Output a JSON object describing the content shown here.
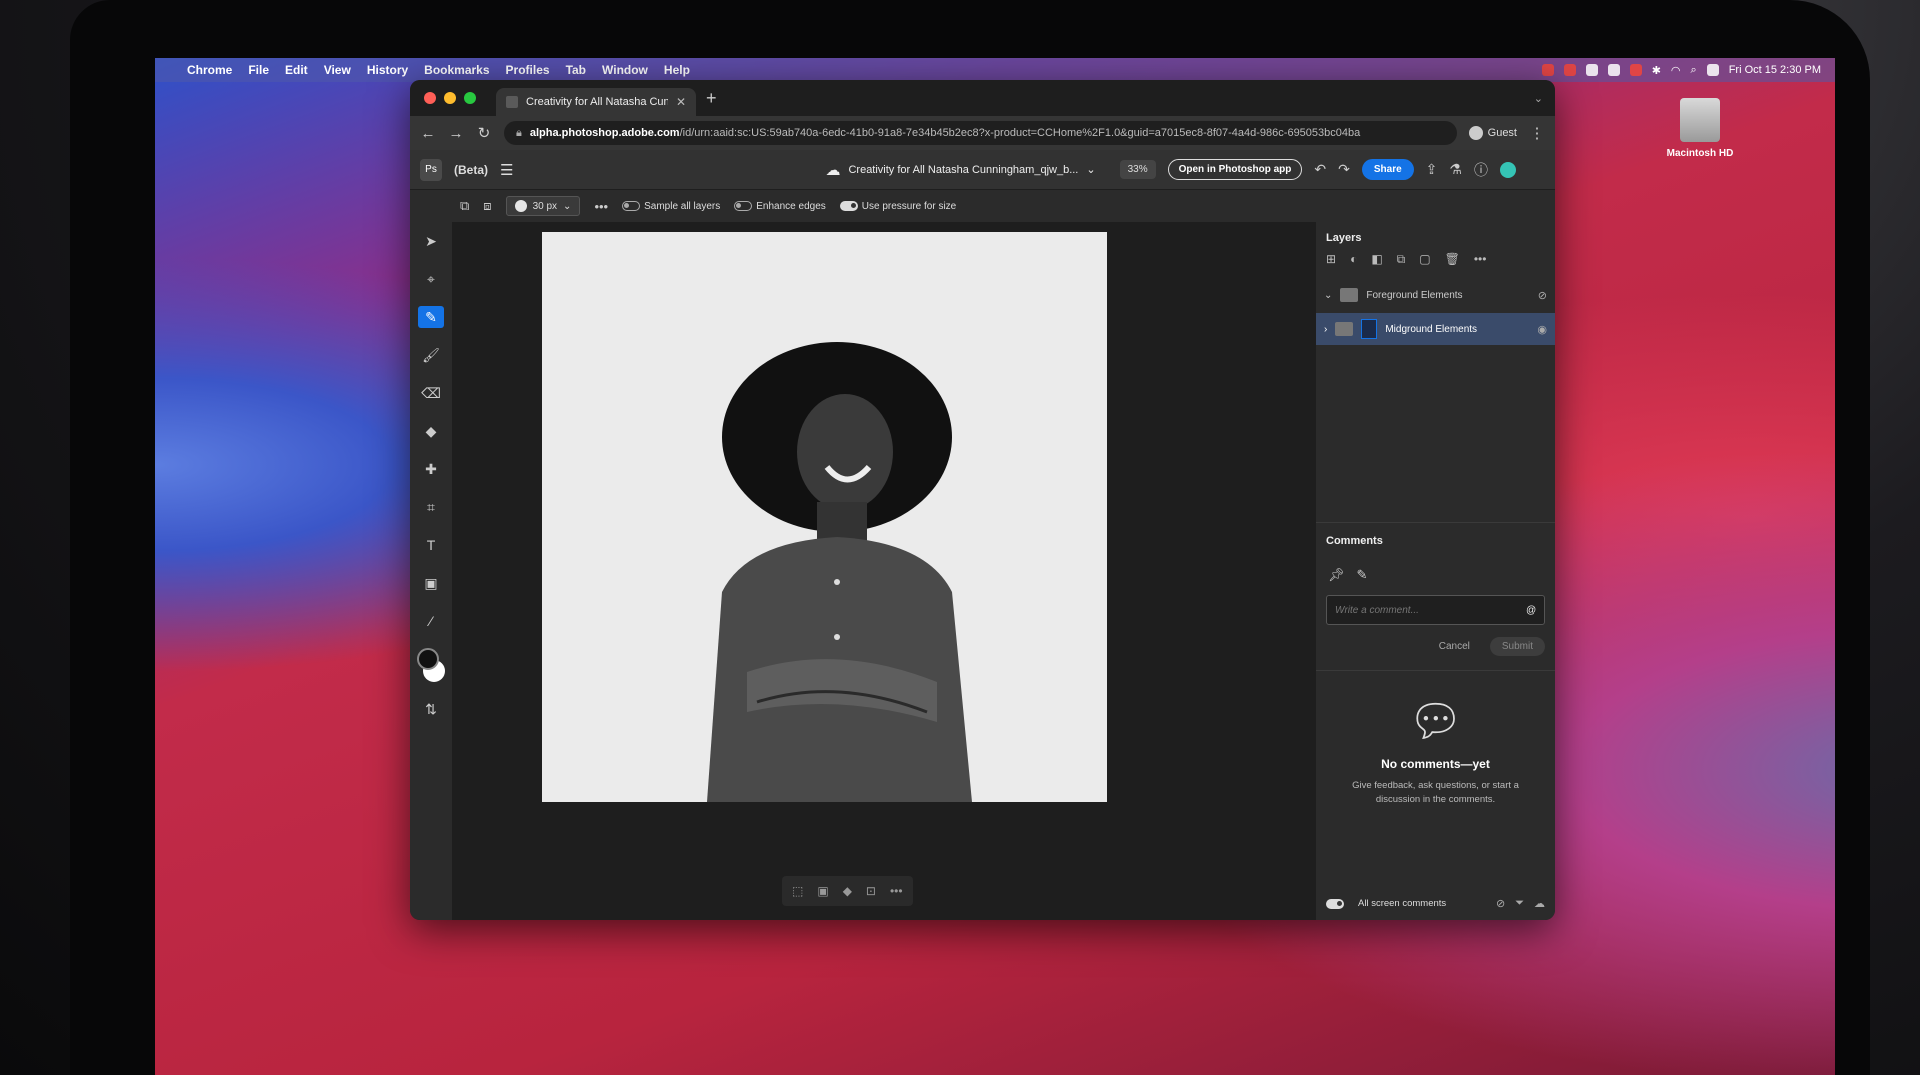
{
  "menubar": {
    "apple": "",
    "items": [
      "Chrome",
      "File",
      "Edit",
      "View",
      "History",
      "Bookmarks",
      "Profiles",
      "Tab",
      "Window",
      "Help"
    ],
    "clock": "Fri Oct 15  2:30 PM"
  },
  "desktop": {
    "drive_label": "Macintosh HD"
  },
  "browser": {
    "tab_title": "Creativity for All Natasha Cunn",
    "url_host": "alpha.photoshop.adobe.com",
    "url_path": "/id/urn:aaid:sc:US:59ab740a-6edc-41b0-91a8-7e34b45b2ec8?x-product=CCHome%2F1.0&guid=a7015ec8-8f07-4a4d-986c-695053bc04ba",
    "profile_label": "Guest"
  },
  "ps_header": {
    "logo": "Ps",
    "beta_label": "(Beta)",
    "document_title": "Creativity for All Natasha Cunningham_qjw_b...",
    "zoom": "33%",
    "open_button": "Open in Photoshop app",
    "share_button": "Share"
  },
  "options_bar": {
    "brush_size": "30 px",
    "sample_all_layers": "Sample all layers",
    "enhance_edges": "Enhance edges",
    "use_pressure": "Use pressure for size"
  },
  "layers": {
    "title": "Layers",
    "items": [
      {
        "name": "Foreground Elements",
        "visible": false,
        "selected": false
      },
      {
        "name": "Midground Elements",
        "visible": true,
        "selected": true
      }
    ]
  },
  "comments": {
    "title": "Comments",
    "placeholder": "Write a comment...",
    "cancel": "Cancel",
    "submit": "Submit",
    "empty_title": "No comments—yet",
    "empty_desc": "Give feedback, ask questions, or start a discussion in the comments.",
    "footer_toggle": "All screen comments"
  },
  "colors": {
    "accent": "#1473e6",
    "panel_bg": "#2b2b2b",
    "canvas_bg": "#ebebeb"
  }
}
